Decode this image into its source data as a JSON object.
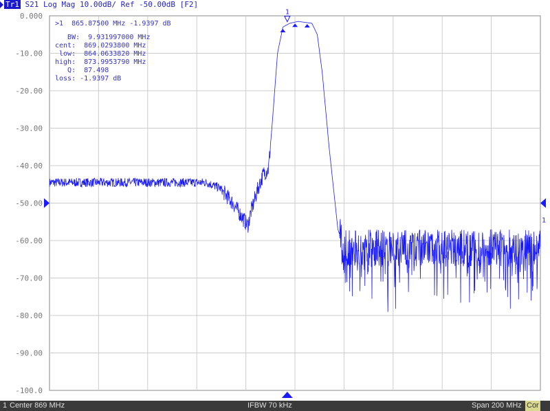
{
  "header": {
    "trace": "Tr1",
    "label": "S21 Log Mag 10.00dB/ Ref -50.00dB [F2]"
  },
  "y_ticks": [
    "0.000",
    "-10.00",
    "-20.00",
    "-30.00",
    "-40.00",
    "-50.00",
    "-60.00",
    "-70.00",
    "-80.00",
    "-90.00",
    "-100.0"
  ],
  "marker_readout": {
    "line": ">1  865.87500 MHz -1.9397 dB",
    "bw": "   BW:  9.931997000 MHz",
    "cent": "cent:  869.0293800 MHz",
    "low": " low:  864.0633820 MHz",
    "high": "high:  873.9953790 MHz",
    "q": "   Q:  87.498",
    "loss": "loss: -1.9397 dB"
  },
  "marker_label": "1",
  "ref_marker_label": "1",
  "status": {
    "channel": "1",
    "center": "Center 869 MHz",
    "ifbw": "IFBW 70 kHz",
    "span": "Span 200 MHz",
    "cor": "Cor"
  },
  "chart_data": {
    "type": "line",
    "xlim": [
      769,
      969
    ],
    "ylim": [
      -100,
      0
    ],
    "ref_level": -50,
    "trace_color": "#1a1aff",
    "points": [
      [
        769,
        -44.5
      ],
      [
        832.9,
        -44.5
      ],
      [
        838.5,
        -46
      ],
      [
        843.7,
        -50
      ],
      [
        849.8,
        -56
      ],
      [
        851.2,
        -52
      ],
      [
        854,
        -46
      ],
      [
        856.3,
        -42
      ],
      [
        858.2,
        -41
      ],
      [
        859.6,
        -30
      ],
      [
        861.9,
        -10
      ],
      [
        864.1,
        -3
      ],
      [
        866.9,
        -2
      ],
      [
        870.3,
        -1.5
      ],
      [
        875.9,
        -2
      ],
      [
        878.1,
        -5
      ],
      [
        880.1,
        -15
      ],
      [
        882.9,
        -35
      ],
      [
        886.5,
        -57
      ],
      [
        889,
        -62
      ],
      [
        969,
        -62
      ]
    ],
    "marker_freq": 865.875,
    "marker_db": -1.9397,
    "low_freq": 864.063,
    "high_freq": 873.995
  }
}
